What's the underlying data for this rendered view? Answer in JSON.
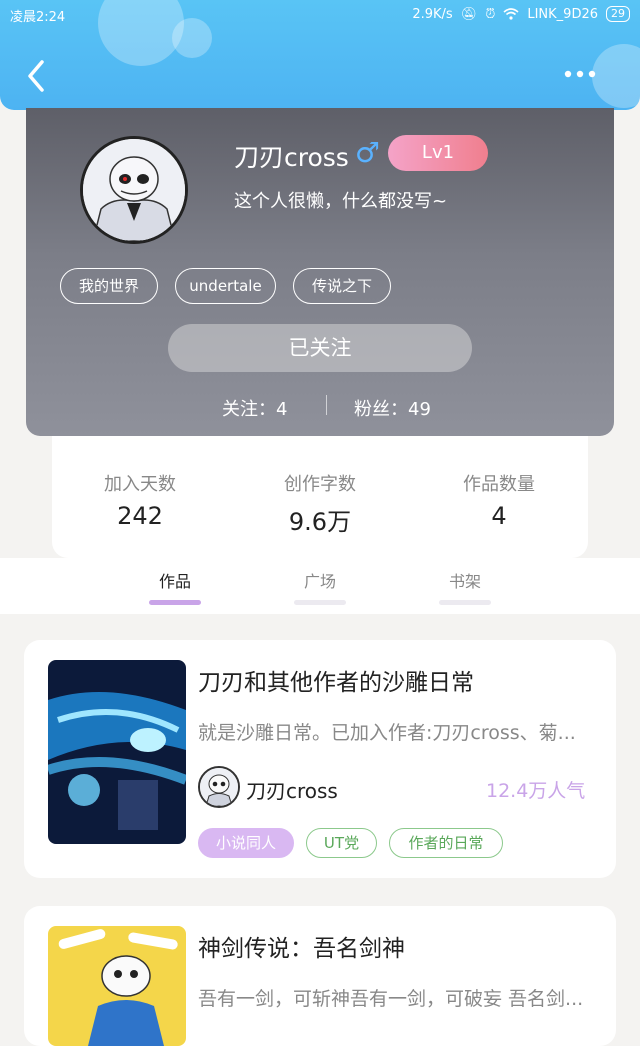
{
  "status_bar": {
    "time": "凌晨2:24",
    "net_speed": "2.9K/s",
    "wifi_name": "LINK_9D26",
    "battery": "29"
  },
  "profile": {
    "username": "刀刃cross",
    "gender_icon": "male-symbol-icon",
    "gender_glyph": "♂",
    "level": "Lv1",
    "bio": "这个人很懒，什么都没写~",
    "tags": [
      "我的世界",
      "undertale",
      "传说之下"
    ],
    "follow_label": "已关注",
    "following": "关注：4",
    "followers": "粉丝：49"
  },
  "stats": [
    {
      "label": "加入天数",
      "value": "242"
    },
    {
      "label": "创作字数",
      "value": "9.6万"
    },
    {
      "label": "作品数量",
      "value": "4"
    }
  ],
  "tabs": [
    {
      "label": "作品",
      "active": true
    },
    {
      "label": "广场",
      "active": false
    },
    {
      "label": "书架",
      "active": false
    }
  ],
  "works": [
    {
      "title": "刀刃和其他作者的沙雕日常",
      "desc": "就是沙雕日常。已加入作者:刀刃cross、菊...",
      "author": "刀刃cross",
      "popularity": "12.4万人气",
      "tags": [
        "小说同人",
        "UT党",
        "作者的日常"
      ]
    },
    {
      "title": "神剑传说：吾名剑神",
      "desc": "吾有一剑，可斩神吾有一剑，可破妄 吾名剑..."
    }
  ],
  "colors": {
    "header": "#4db3f2",
    "accent_purple": "#c9a4e8",
    "level_badge": "#f07f8e",
    "tag_green": "#5aa85a"
  }
}
